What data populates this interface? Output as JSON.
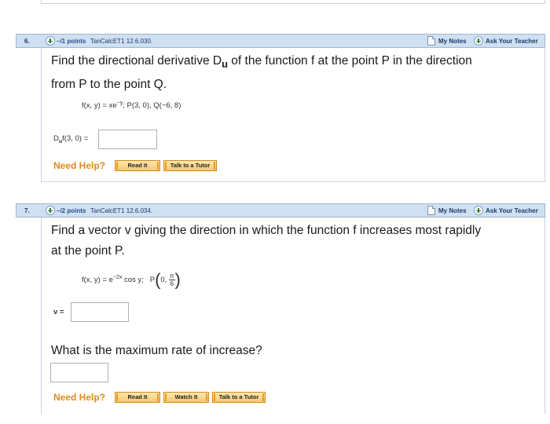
{
  "questions": [
    {
      "number": "6.",
      "points": "–/1 points",
      "source": "TanCalcET1 12.6.030.",
      "my_notes": "My Notes",
      "ask_teacher": "Ask Your Teacher",
      "prompt_line1": "Find the directional derivative D",
      "prompt_sub": "u",
      "prompt_line1_rest": " of the function f at the point P in the direction",
      "prompt_line2": "from P to the point Q.",
      "formula": "f(x, y) = xe",
      "formula_exp": "−y",
      "formula_rest": ";    P(3, 0),    Q(−6, 8)",
      "answer_label": "D",
      "answer_label_sub": "u",
      "answer_label_rest": "f(3, 0) =",
      "need_help": "Need Help?",
      "buttons": [
        "Read It",
        "Talk to a Tutor"
      ]
    },
    {
      "number": "7.",
      "points": "–/2 points",
      "source": "TanCalcET1 12.6.034.",
      "my_notes": "My Notes",
      "ask_teacher": "Ask Your Teacher",
      "prompt_line1": "Find a vector v giving the direction in which the function f increases most rapidly",
      "prompt_line2": "at the point P.",
      "formula": "f(x, y) = e",
      "formula_exp": "−2x",
      "formula_rest": " cos y;",
      "point_label": "P",
      "point_first": "0,",
      "point_num": "π",
      "point_den": "6",
      "answer_label": "v =",
      "second_prompt": "What is the maximum rate of increase?",
      "need_help": "Need Help?",
      "buttons": [
        "Read It",
        "Watch It",
        "Talk to a Tutor"
      ]
    }
  ]
}
